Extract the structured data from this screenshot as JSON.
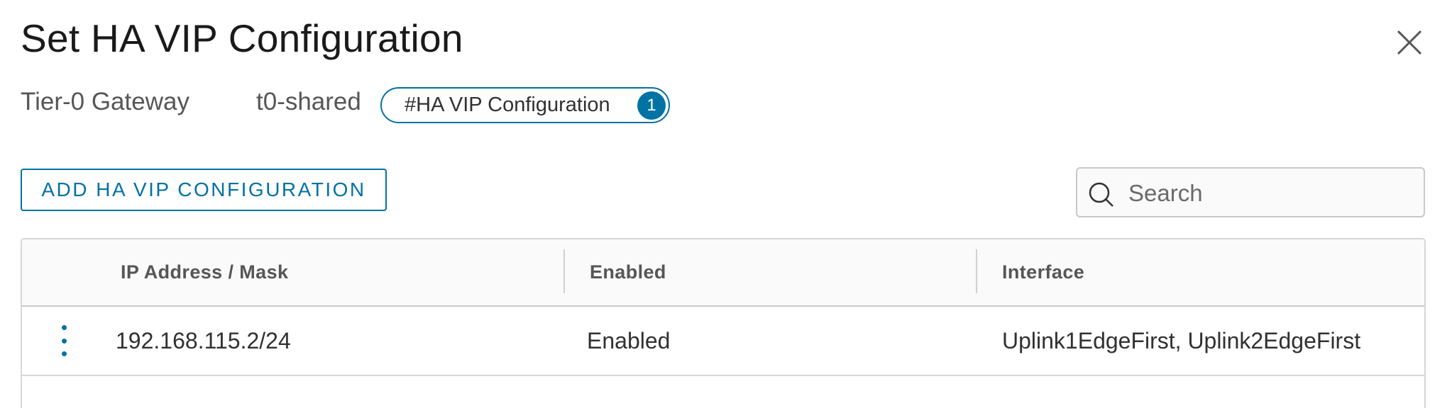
{
  "dialog": {
    "title": "Set HA VIP Configuration",
    "close_icon": "close-icon"
  },
  "subheader": {
    "gateway_type": "Tier-0 Gateway",
    "gateway_name": "t0-shared",
    "badge_label": "#HA VIP Configuration",
    "badge_count": "1"
  },
  "toolbar": {
    "add_label": "ADD HA VIP CONFIGURATION",
    "search_placeholder": "Search",
    "search_value": "",
    "search_icon": "search-icon"
  },
  "grid": {
    "columns": [
      "IP Address / Mask",
      "Enabled",
      "Interface"
    ],
    "rows": [
      {
        "ip": "192.168.115.2/24",
        "enabled": "Enabled",
        "interface": "Uplink1EdgeFirst, Uplink2EdgeFirst",
        "menu_icon": "vertical-ellipsis-icon"
      }
    ]
  },
  "colors": {
    "accent": "#0072a3",
    "text": "#313131",
    "muted": "#565656",
    "border": "#d7d7d7"
  }
}
